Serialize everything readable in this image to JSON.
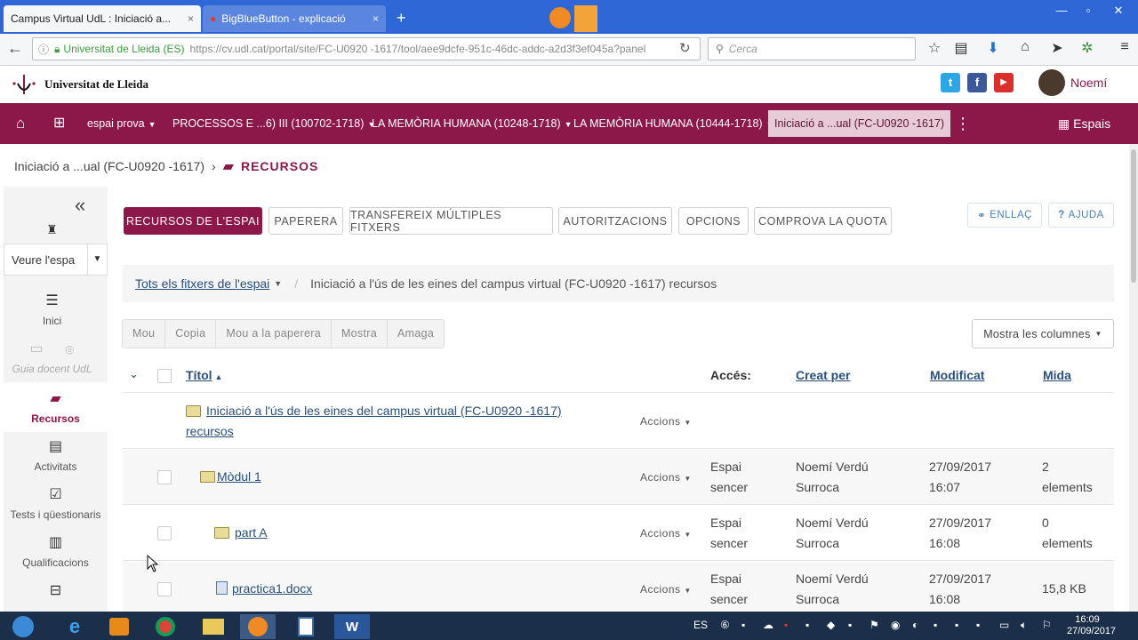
{
  "browser": {
    "tabs": [
      {
        "title": "Campus Virtual UdL : Iniciació a...",
        "close": "×"
      },
      {
        "title": "BigBlueButton - explicació",
        "close": "×"
      }
    ],
    "new_tab": "+",
    "url_secure_label": "Universitat de Lleida (ES)",
    "url": "https://cv.udl.cat/portal/site/FC-U0920 -1617/tool/aee9dcfe-951c-46dc-addc-a2d3f3ef045a?panel",
    "search_placeholder": "Cerca"
  },
  "site": {
    "logo_text": "Universitat de Lleida",
    "user_name": "Noemí",
    "colors": {
      "brand": "#8c1749",
      "link": "#2a4f7a"
    }
  },
  "topnav": {
    "items": [
      {
        "label": "espai prova"
      },
      {
        "label": "PROCESSOS E ...6) III (100702-1718)"
      },
      {
        "label": "LA MEMÒRIA HUMANA (10248-1718)"
      },
      {
        "label": "LA MEMÒRIA HUMANA (10444-1718)"
      }
    ],
    "current": "Iniciació a ...ual (FC-U0920 -1617)",
    "spaces_label": "Espais"
  },
  "breadcrumb": {
    "site": "Iniciació a ...ual (FC-U0920 -1617)",
    "section": "RECURSOS"
  },
  "sidebar": {
    "collapse": "«",
    "view_select": "Veure l'espa",
    "items": [
      {
        "label": "Inici"
      },
      {
        "label": "Guia docent UdL"
      },
      {
        "label": "Recursos"
      },
      {
        "label": "Activitats"
      },
      {
        "label": "Tests i qüestionaris"
      },
      {
        "label": "Qualificacions"
      }
    ]
  },
  "toolbar": {
    "buttons": [
      "RECURSOS DE L'ESPAI",
      "PAPERERA",
      "TRANSFEREIX MÚLTIPLES FITXERS",
      "AUTORITZACIONS",
      "OPCIONS",
      "COMPROVA LA QUOTA"
    ],
    "link_label": "ENLLAÇ",
    "help_label": "AJUDA"
  },
  "path": {
    "all_files": "Tots els fitxers de l'espai",
    "current": "Iniciació a l'ús de les eines del campus virtual (FC-U0920 -1617) recursos"
  },
  "actions": [
    "Mou",
    "Copia",
    "Mou a la paperera",
    "Mostra",
    "Amaga"
  ],
  "columns_button": "Mostra les columnes",
  "table": {
    "headers": {
      "title": "Títol",
      "access": "Accés:",
      "created_by": "Creat per",
      "modified": "Modificat",
      "size": "Mida"
    },
    "actions_label": "Accions",
    "root": {
      "name_line1": "Iniciació a l'ús de les eines del campus virtual (FC-U0920 -1617)",
      "name_line2": "recursos"
    },
    "rows": [
      {
        "name": "Mòdul 1",
        "access1": "Espai",
        "access2": "sencer",
        "creator1": "Noemí Verdú",
        "creator2": "Surroca",
        "date": "27/09/2017",
        "time": "16:07",
        "size1": "2",
        "size2": "elements"
      },
      {
        "name": "part A",
        "access1": "Espai",
        "access2": "sencer",
        "creator1": "Noemí Verdú",
        "creator2": "Surroca",
        "date": "27/09/2017",
        "time": "16:08",
        "size1": "0",
        "size2": "elements"
      },
      {
        "name": "practica1.docx",
        "access1": "Espai",
        "access2": "sencer",
        "creator1": "Noemí Verdú",
        "creator2": "Surroca",
        "date": "27/09/2017",
        "time": "16:08",
        "size1": "15,8 KB",
        "size2": ""
      }
    ]
  },
  "taskbar": {
    "lang": "ES",
    "time": "16:09",
    "date": "27/09/2017"
  }
}
